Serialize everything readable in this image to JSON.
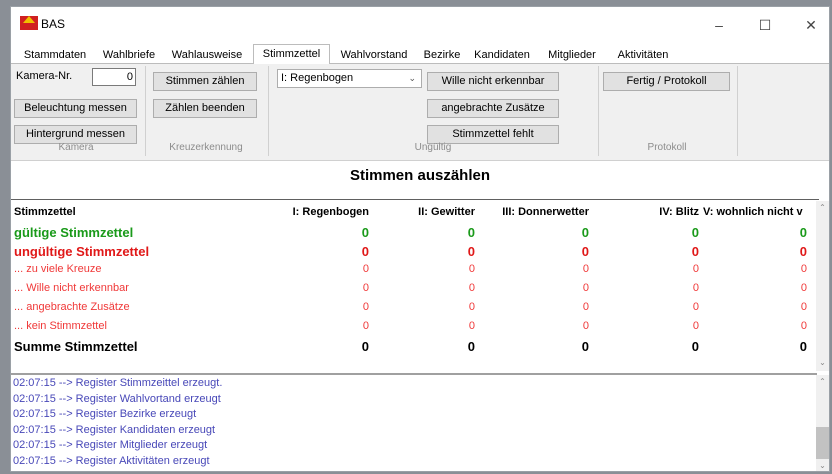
{
  "window": {
    "title": "BAS",
    "controls": [
      "–",
      "☐",
      "✕"
    ]
  },
  "tabs": [
    "Stammdaten",
    "Wahlbriefe",
    "Wahlausweise",
    "Stimmzettel",
    "Wahlvorstand",
    "Bezirke",
    "Kandidaten",
    "Mitglieder",
    "Aktivitäten"
  ],
  "active_tab": "Stimmzettel",
  "ribbon": {
    "camera": {
      "label_nr": "Kamera-Nr.",
      "nr_value": "0",
      "light_button": "Beleuchtung messen",
      "background_button": "Hintergrund messen",
      "group_label": "Kamera"
    },
    "cross": {
      "count_button": "Stimmen zählen",
      "stop_button": "Zählen beenden",
      "group_label": "Kreuzerkennung"
    },
    "invalid": {
      "select_value": "I: Regenbogen",
      "intent_button": "Wille nicht erkennbar",
      "additions_button": "angebrachte Zusätze",
      "missing_button": "Stimmzettel fehlt",
      "group_label": "Ungültig"
    },
    "protocol": {
      "finish_button": "Fertig / Protokoll",
      "group_label": "Protokoll"
    }
  },
  "heading": "Stimmen auszählen",
  "table": {
    "columns": [
      "Stimmzettel",
      "I: Regenbogen",
      "II: Gewitter",
      "III: Donnerwetter",
      "IV: Blitz",
      "V: wohnlich nicht v"
    ],
    "rows": [
      {
        "label": "gültige Stimmzettel",
        "values": [
          "0",
          "0",
          "0",
          "0",
          "0"
        ],
        "color": "#1a9a1a",
        "bold": true,
        "size": 13
      },
      {
        "label": "ungültige Stimmzettel",
        "values": [
          "0",
          "0",
          "0",
          "0",
          "0"
        ],
        "color": "#e01818",
        "bold": true,
        "size": 13
      },
      {
        "label": "... zu viele Kreuze",
        "values": [
          "0",
          "0",
          "0",
          "0",
          "0"
        ],
        "color": "#f03838",
        "bold": false,
        "size": 11
      },
      {
        "label": "... Wille nicht erkennbar",
        "values": [
          "0",
          "0",
          "0",
          "0",
          "0"
        ],
        "color": "#f03838",
        "bold": false,
        "size": 11
      },
      {
        "label": "... angebrachte Zusätze",
        "values": [
          "0",
          "0",
          "0",
          "0",
          "0"
        ],
        "color": "#f03838",
        "bold": false,
        "size": 11
      },
      {
        "label": "... kein Stimmzettel",
        "values": [
          "0",
          "0",
          "0",
          "0",
          "0"
        ],
        "color": "#f03838",
        "bold": false,
        "size": 11
      },
      {
        "label": "Summe Stimmzettel",
        "values": [
          "0",
          "0",
          "0",
          "0",
          "0"
        ],
        "color": "#000000",
        "bold": true,
        "size": 13
      }
    ]
  },
  "log": [
    "02:07:15 --> Register Stimmzeittel erzeugt.",
    "02:07:15 --> Register Wahlvortand erzeugt",
    "02:07:15 --> Register Bezirke erzeugt",
    "02:07:15 --> Register Kandidaten erzeugt",
    "02:07:15 --> Register Mitglieder erzeugt",
    "02:07:15 --> Register Aktivitäten erzeugt"
  ]
}
